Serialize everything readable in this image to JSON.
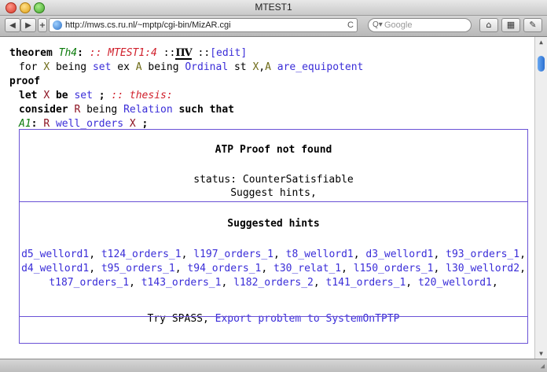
{
  "window": {
    "title": "MTEST1"
  },
  "toolbar": {
    "back_icon": "◀",
    "forward_icon": "▶",
    "add_icon": "+",
    "url": "http://mws.cs.ru.nl/~mptp/cgi-bin/MizAR.cgi",
    "reload_icon": "C",
    "search_placeholder": "Google",
    "search_icon": "Q▾",
    "home_icon": "⌂",
    "grid_icon": "▦",
    "edit_icon": "✎"
  },
  "theorem": {
    "keyword": "theorem",
    "label": "Th4",
    "colon": ":",
    "ref": ":: MTEST1:4",
    "sep1": "::",
    "sep2": "::",
    "edit": "[edit]",
    "logo_text": "ΠV"
  },
  "statement": {
    "t1": "for ",
    "v1": "X",
    "t2": " being ",
    "set": "set",
    "t3": " ex ",
    "v2": "A",
    "t4": " being ",
    "ordinal": "Ordinal",
    "t5": " st ",
    "v3": "X",
    "t6": ",",
    "v4": "A",
    "t7": " ",
    "pred": "are_equipotent"
  },
  "proof": {
    "keyword": "proof",
    "let_kw": "let",
    "let_var": "X",
    "be_kw": "be",
    "set": "set",
    "semi": ";",
    "thesis": ":: thesis:",
    "consider_kw": "consider",
    "consider_var": "R",
    "being_kw": "being",
    "relation": "Relation",
    "such_that": "such that",
    "a1_label": "A1",
    "a1_colon": ":",
    "a1_var": "R",
    "a1_pred": "well_orders",
    "a1_arg": "X",
    "a1_semi": ";"
  },
  "atp": {
    "title": "ATP Proof not found",
    "status": "status: CounterSatisfiable",
    "suggest": "Suggest hints,"
  },
  "hints": {
    "title": "Suggested hints",
    "items": [
      "d5_wellord1",
      "t124_orders_1",
      "l197_orders_1",
      "t8_wellord1",
      "d3_wellord1",
      "t93_orders_1",
      "d4_wellord1",
      "t95_orders_1",
      "t94_orders_1",
      "t30_relat_1",
      "l150_orders_1",
      "l30_wellord2",
      "t187_orders_1",
      "t143_orders_1",
      "l182_orders_2",
      "t141_orders_1",
      "t20_wellord1"
    ],
    "sep": ", ",
    "trail": ","
  },
  "footer": {
    "try": "Try SPASS,",
    "export": "Export problem to SystemOnTPTP"
  },
  "scrollbar": {
    "up": "▲",
    "down": "▼"
  }
}
